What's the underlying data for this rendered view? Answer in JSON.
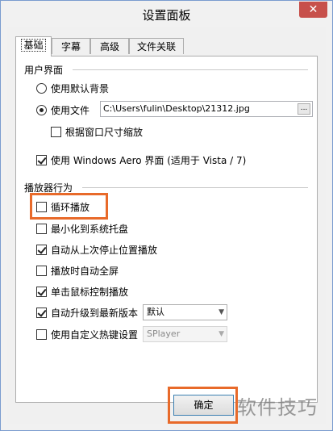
{
  "window": {
    "title": "设置面板",
    "close_icon": "close-icon"
  },
  "tabs": [
    {
      "label": "基础",
      "active": true
    },
    {
      "label": "字幕",
      "active": false
    },
    {
      "label": "高级",
      "active": false
    },
    {
      "label": "文件关联",
      "active": false
    }
  ],
  "ui_group": {
    "title": "用户界面",
    "radio_default_bg": {
      "label": "使用默认背景",
      "selected": false
    },
    "radio_use_file": {
      "label": "使用文件",
      "selected": true
    },
    "file_path": "C:\\Users\\fulin\\Desktop\\21312.jpg",
    "browse_label": "...",
    "scale_by_window": {
      "label": "根据窗口尺寸缩放",
      "checked": false
    },
    "aero": {
      "label": "使用 Windows Aero 界面 (适用于 Vista / 7)",
      "checked": true
    }
  },
  "player_group": {
    "title": "播放器行为",
    "loop": {
      "label": "循环播放",
      "checked": false
    },
    "minimize_tray": {
      "label": "最小化到系统托盘",
      "checked": false
    },
    "resume": {
      "label": "自动从上次停止位置播放",
      "checked": true
    },
    "auto_fullscreen": {
      "label": "播放时自动全屏",
      "checked": false
    },
    "click_control": {
      "label": "单击鼠标控制播放",
      "checked": true
    },
    "auto_upgrade": {
      "label": "自动升级到最新版本",
      "checked": true,
      "option": "默认"
    },
    "hotkeys": {
      "label": "使用自定义热键设置",
      "checked": false,
      "option": "SPlayer"
    }
  },
  "buttons": {
    "ok": "确定"
  },
  "overlay": {
    "watermark": "软件技巧",
    "highlight_color": "#e86a2a"
  }
}
